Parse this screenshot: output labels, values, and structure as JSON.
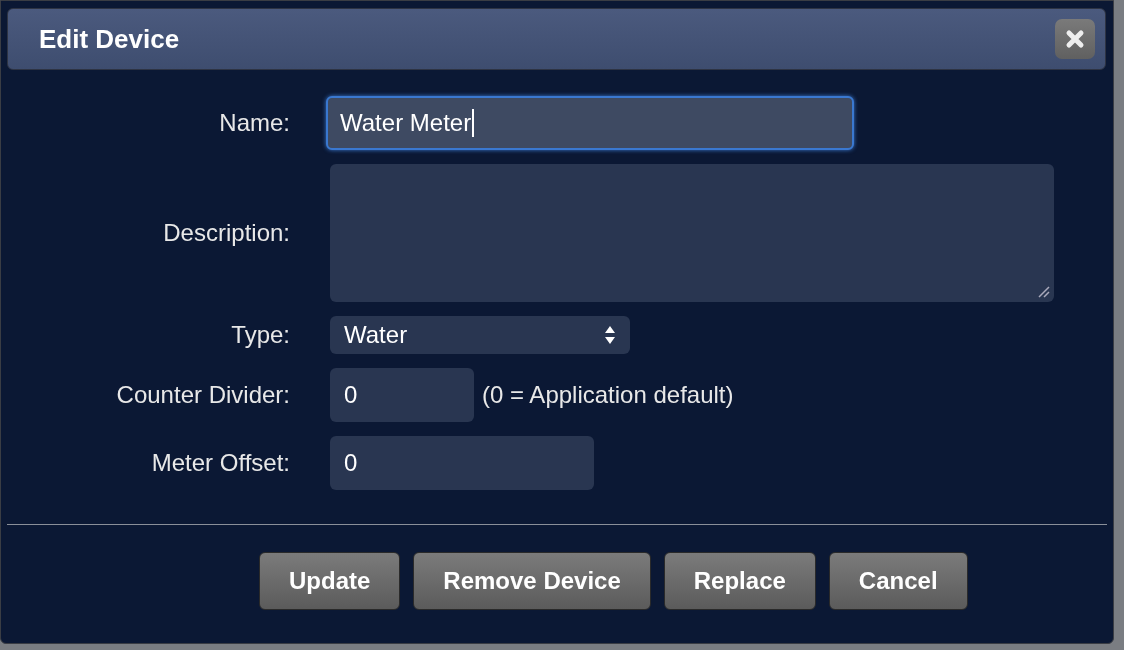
{
  "dialog": {
    "title": "Edit Device"
  },
  "fields": [
    {
      "label": "Name:",
      "kind": "text",
      "value": "Water Meter",
      "focused": true
    },
    {
      "label": "Description:",
      "kind": "textarea",
      "focused": false
    },
    {
      "label": "Type:",
      "kind": "select",
      "value": "Water",
      "focused": false
    },
    {
      "label": "Counter Divider:",
      "kind": "short",
      "value": "0",
      "note": "(0 = Application default)",
      "focused": false
    },
    {
      "label": "Meter Offset:",
      "kind": "medium",
      "value": "0",
      "focused": false
    }
  ],
  "buttons": [
    "Update",
    "Remove Device",
    "Replace",
    "Cancel"
  ]
}
